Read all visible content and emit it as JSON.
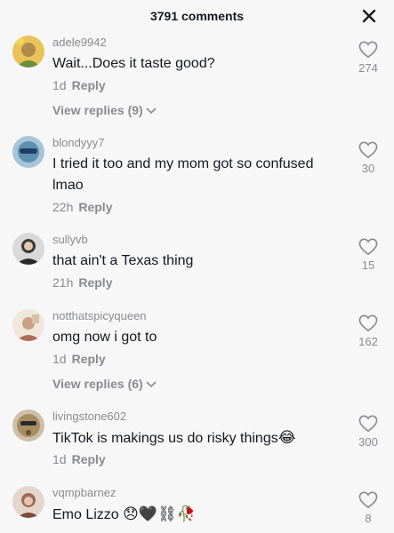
{
  "header": {
    "title": "3791 comments"
  },
  "comments": [
    {
      "username": "adele9942",
      "text": "Wait...Does it taste good?",
      "time": "1d",
      "reply_label": "Reply",
      "likes": "274",
      "view_replies": "View replies (9)",
      "avatar_color": "#b08a4a"
    },
    {
      "username": "blondyyy7",
      "text": "I tried it too and my mom got so confused lmao",
      "time": "22h",
      "reply_label": "Reply",
      "likes": "30",
      "avatar_color": "#5d8fb0"
    },
    {
      "username": "sullyvb",
      "text": "that ain't a Texas thing",
      "time": "21h",
      "reply_label": "Reply",
      "likes": "15",
      "avatar_color": "#3a3a3a"
    },
    {
      "username": "notthatspicyqueen",
      "text": "omg now i got to",
      "time": "1d",
      "reply_label": "Reply",
      "likes": "162",
      "view_replies": "View replies (6)",
      "avatar_color": "#c9a184"
    },
    {
      "username": "livingstone602",
      "text": "TikTok is makings us do risky things",
      "text_emoji": "😂",
      "time": "1d",
      "reply_label": "Reply",
      "likes": "300",
      "avatar_color": "#a88d62"
    },
    {
      "username": "vqmpbarnez",
      "text": "Emo Lizzo",
      "text_emoji": "😞🖤⛓🥀",
      "likes": "8",
      "avatar_color": "#9c6a55"
    }
  ]
}
